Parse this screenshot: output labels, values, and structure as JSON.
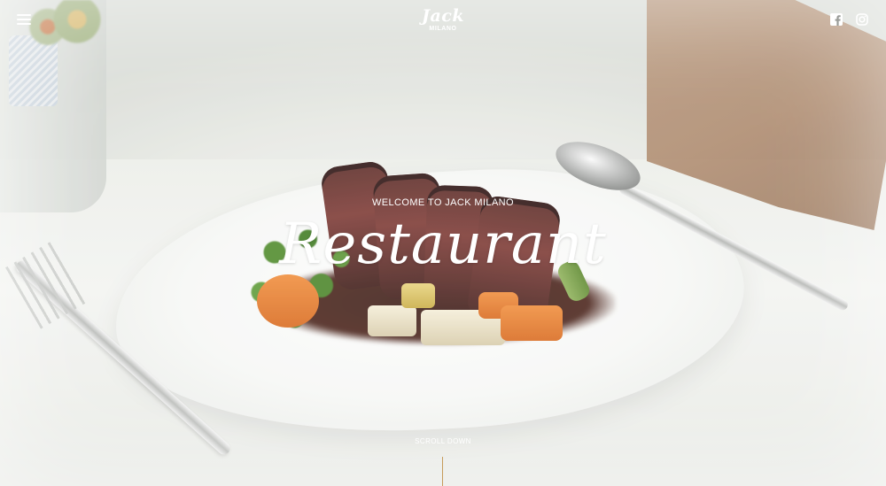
{
  "header": {
    "brand_name": "Jack",
    "brand_city": "MILANO",
    "menu_icon": "hamburger-menu-icon",
    "social": [
      {
        "name": "facebook",
        "icon": "facebook-icon"
      },
      {
        "name": "instagram",
        "icon": "instagram-icon"
      }
    ]
  },
  "hero": {
    "eyebrow": "WELCOME TO JACK MILANO",
    "title": "Restaurant",
    "scroll_label": "SCROLL DOWN",
    "accent_color": "#c69c5a",
    "text_color": "#ffffff"
  }
}
